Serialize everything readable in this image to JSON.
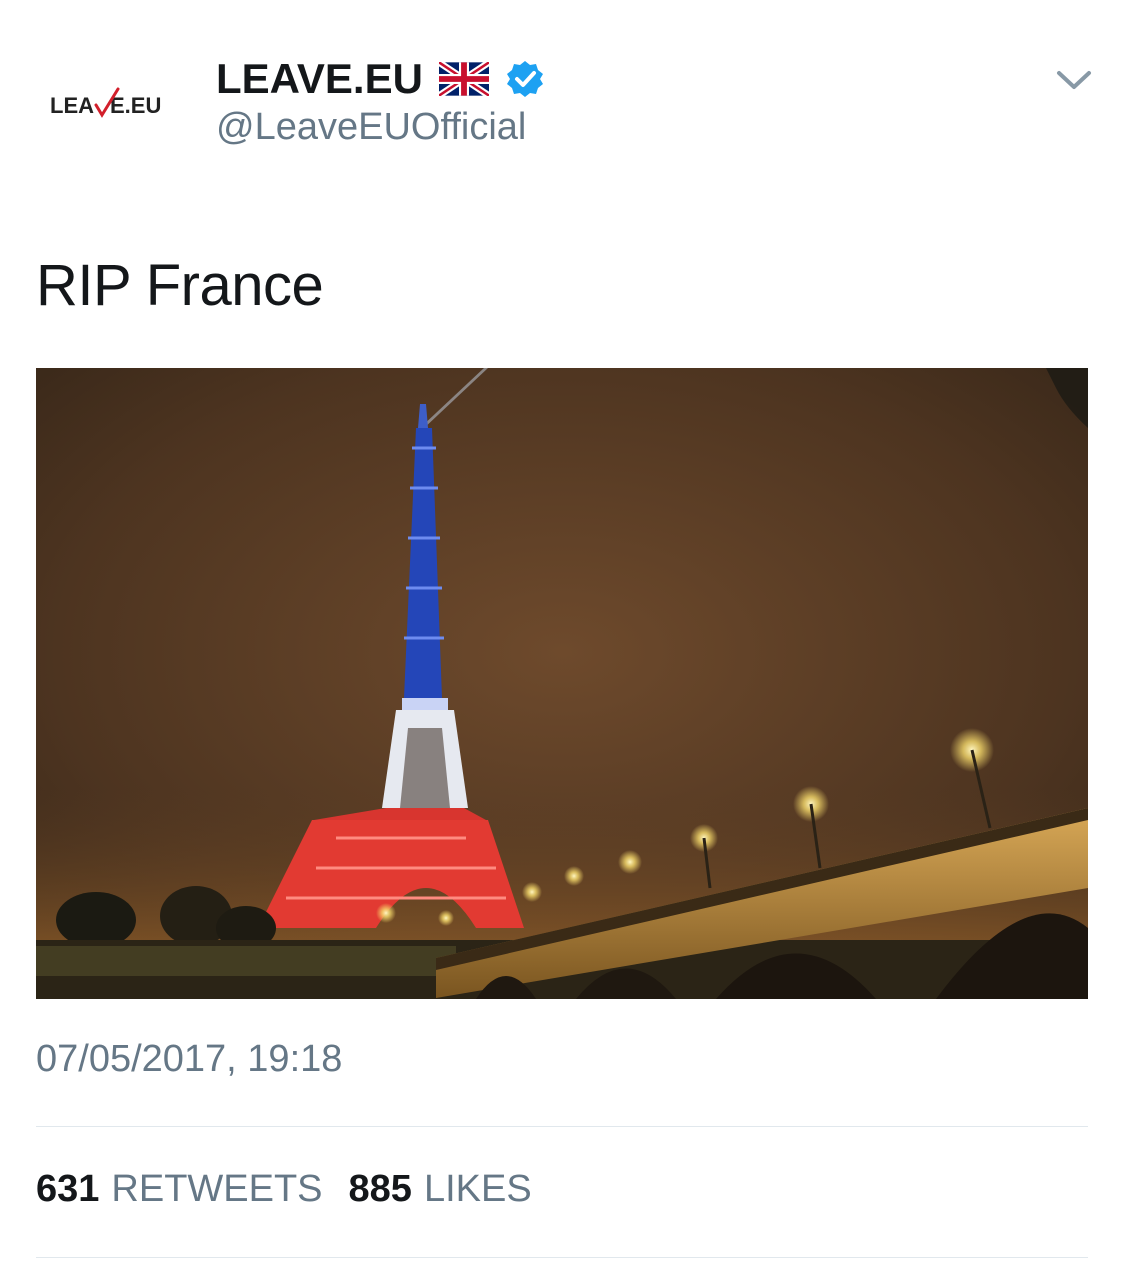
{
  "author": {
    "avatar_text": "LEA  E.EU",
    "display_name": "LEAVE.EU",
    "handle": "@LeaveEUOfficial",
    "flag_icon": "union-jack-flag-icon",
    "verified_icon": "verified-badge-icon",
    "verified_color": "#1da1f2"
  },
  "tweet": {
    "text": "RIP France",
    "timestamp": "07/05/2017, 19:18"
  },
  "stats": {
    "retweets_count": "631",
    "retweets_label": "RETWEETS",
    "likes_count": "885",
    "likes_label": "LIKES"
  },
  "colors": {
    "text_primary": "#14171a",
    "text_secondary": "#657786",
    "divider": "#e1e8ed",
    "accent": "#1da1f2"
  }
}
